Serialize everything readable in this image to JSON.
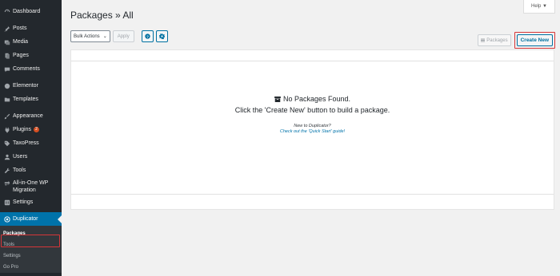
{
  "sidebar": {
    "items": [
      {
        "label": "Dashboard",
        "icon": "dashboard-icon"
      },
      {
        "label": "Posts",
        "icon": "pin-icon"
      },
      {
        "label": "Media",
        "icon": "media-icon"
      },
      {
        "label": "Pages",
        "icon": "pages-icon"
      },
      {
        "label": "Comments",
        "icon": "comments-icon"
      },
      {
        "label": "Elementor",
        "icon": "elementor-icon"
      },
      {
        "label": "Templates",
        "icon": "folder-icon"
      },
      {
        "label": "Appearance",
        "icon": "brush-icon"
      },
      {
        "label": "Plugins",
        "icon": "plugin-icon",
        "badge": "2"
      },
      {
        "label": "TaxoPress",
        "icon": "tag-icon"
      },
      {
        "label": "Users",
        "icon": "users-icon"
      },
      {
        "label": "Tools",
        "icon": "wrench-icon"
      },
      {
        "label": "All-in-One WP Migration",
        "icon": "migration-icon"
      },
      {
        "label": "Settings",
        "icon": "settings-icon"
      },
      {
        "label": "Duplicator",
        "icon": "duplicator-icon"
      }
    ],
    "submenu": [
      {
        "label": "Packages"
      },
      {
        "label": "Tools"
      },
      {
        "label": "Settings"
      },
      {
        "label": "Go Pro"
      }
    ]
  },
  "header": {
    "help": "Help ▼",
    "title": "Packages » All"
  },
  "toolbar": {
    "bulk_actions": "Bulk Actions",
    "apply": "Apply",
    "packages": "Packages",
    "create_new": "Create New"
  },
  "empty": {
    "line1": "No Packages Found.",
    "line2": "Click the 'Create New' button to build a package.",
    "new_to": "New to Duplicator?",
    "quick_start": "Check out the 'Quick Start' guide!"
  },
  "colors": {
    "sidebar_bg": "#23282d",
    "active_bg": "#0073aa",
    "highlight": "#d63638",
    "link": "#0071a1"
  }
}
